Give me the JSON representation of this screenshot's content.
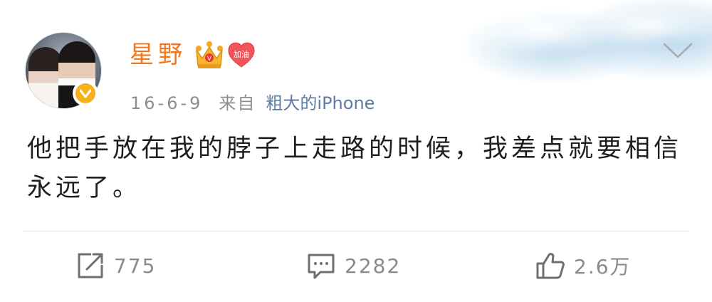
{
  "post": {
    "username": "星野",
    "heart_badge_label": "加油",
    "date": "16-6-9",
    "from_label": "来自",
    "source": "粗大的iPhone",
    "text": "他把手放在我的脖子上走路的时候，我差点就要相信永远了。"
  },
  "actions": {
    "repost_count": "775",
    "comment_count": "2282",
    "like_count": "2.6万"
  },
  "colors": {
    "username": "#f57620",
    "source_link": "#5b7aa5",
    "verified_badge": "#f5b21b",
    "heart_badge": "#f2545b",
    "crown": "#f4a81d"
  },
  "icons": {
    "repost": "repost-icon",
    "comment": "comment-icon",
    "like": "thumbs-up-icon",
    "menu": "chevron-down-icon",
    "verified": "verified-badge-icon",
    "crown": "crown-icon",
    "heart": "heart-badge-icon"
  }
}
